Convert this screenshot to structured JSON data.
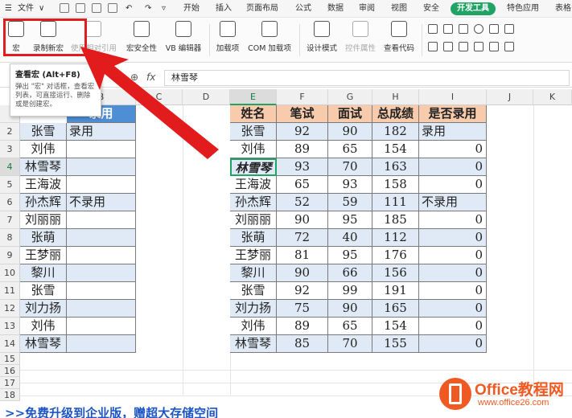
{
  "menubar": {
    "file_label": "文件",
    "tabs": [
      "开始",
      "插入",
      "页面布局",
      "公式",
      "数据",
      "审阅",
      "视图",
      "安全",
      "开发工具",
      "特色应用",
      "表格"
    ],
    "active_tab": "开发工具"
  },
  "ribbon": {
    "macro": "宏",
    "record_macro": "录制新宏",
    "use_relative": "使用相对引用",
    "macro_security": "宏安全性",
    "vb_editor": "VB 编辑器",
    "addins": "加载项",
    "com_addins": "COM 加载项",
    "design_mode": "设计模式",
    "control_props": "控件属性",
    "view_code": "查看代码"
  },
  "tooltip": {
    "title": "查看宏 (Alt+F8)",
    "body": "弹出 \"宏\" 对话框，查看宏列表，可直接运行、删除或是创建宏。"
  },
  "formula_bar": {
    "fx": "fx",
    "value": "林雪琴"
  },
  "columns": [
    "B",
    "C",
    "D",
    "E",
    "F",
    "G",
    "H",
    "I",
    "J",
    "K"
  ],
  "active_column": "E",
  "active_row": "4",
  "rows": [
    "2",
    "3",
    "4",
    "5",
    "6",
    "7",
    "8",
    "9",
    "10",
    "11",
    "12",
    "13",
    "14",
    "15",
    "16",
    "17",
    "18"
  ],
  "left_table": {
    "header_partial": "录用",
    "names": [
      "张雪",
      "刘伟",
      "林雪琴",
      "王海波",
      "孙杰辉",
      "刘丽丽",
      "张萌",
      "王梦丽",
      "黎川",
      "张雪",
      "刘力扬",
      "刘伟",
      "林雪琴"
    ],
    "status": [
      "录用",
      "",
      "",
      "",
      "不录用",
      "",
      "",
      "",
      "",
      "",
      "",
      "",
      ""
    ]
  },
  "right_table": {
    "headers": [
      "姓名",
      "笔试",
      "面试",
      "总成绩",
      "是否录用"
    ],
    "rows": [
      [
        "张雪",
        "92",
        "90",
        "182",
        "录用"
      ],
      [
        "刘伟",
        "89",
        "65",
        "154",
        "0"
      ],
      [
        "林雪琴",
        "93",
        "70",
        "163",
        "0"
      ],
      [
        "王海波",
        "65",
        "93",
        "158",
        "0"
      ],
      [
        "孙杰辉",
        "52",
        "59",
        "111",
        "不录用"
      ],
      [
        "刘丽丽",
        "90",
        "95",
        "185",
        "0"
      ],
      [
        "张萌",
        "72",
        "40",
        "112",
        "0"
      ],
      [
        "王梦丽",
        "81",
        "95",
        "176",
        "0"
      ],
      [
        "黎川",
        "90",
        "66",
        "156",
        "0"
      ],
      [
        "张雪",
        "92",
        "99",
        "191",
        "0"
      ],
      [
        "刘力扬",
        "75",
        "90",
        "165",
        "0"
      ],
      [
        "刘伟",
        "89",
        "65",
        "154",
        "0"
      ],
      [
        "林雪琴",
        "85",
        "70",
        "155",
        "0"
      ]
    ]
  },
  "promo_text": ">>免费升级到企业版，赠超大存储空间",
  "watermark": {
    "title": "Office教程网",
    "url": "www.office26.com"
  },
  "colors": {
    "accent": "#21a366",
    "highlight": "#e21c1c",
    "header_fill": "#f8cbad",
    "row_fill": "#dfeaf6"
  }
}
